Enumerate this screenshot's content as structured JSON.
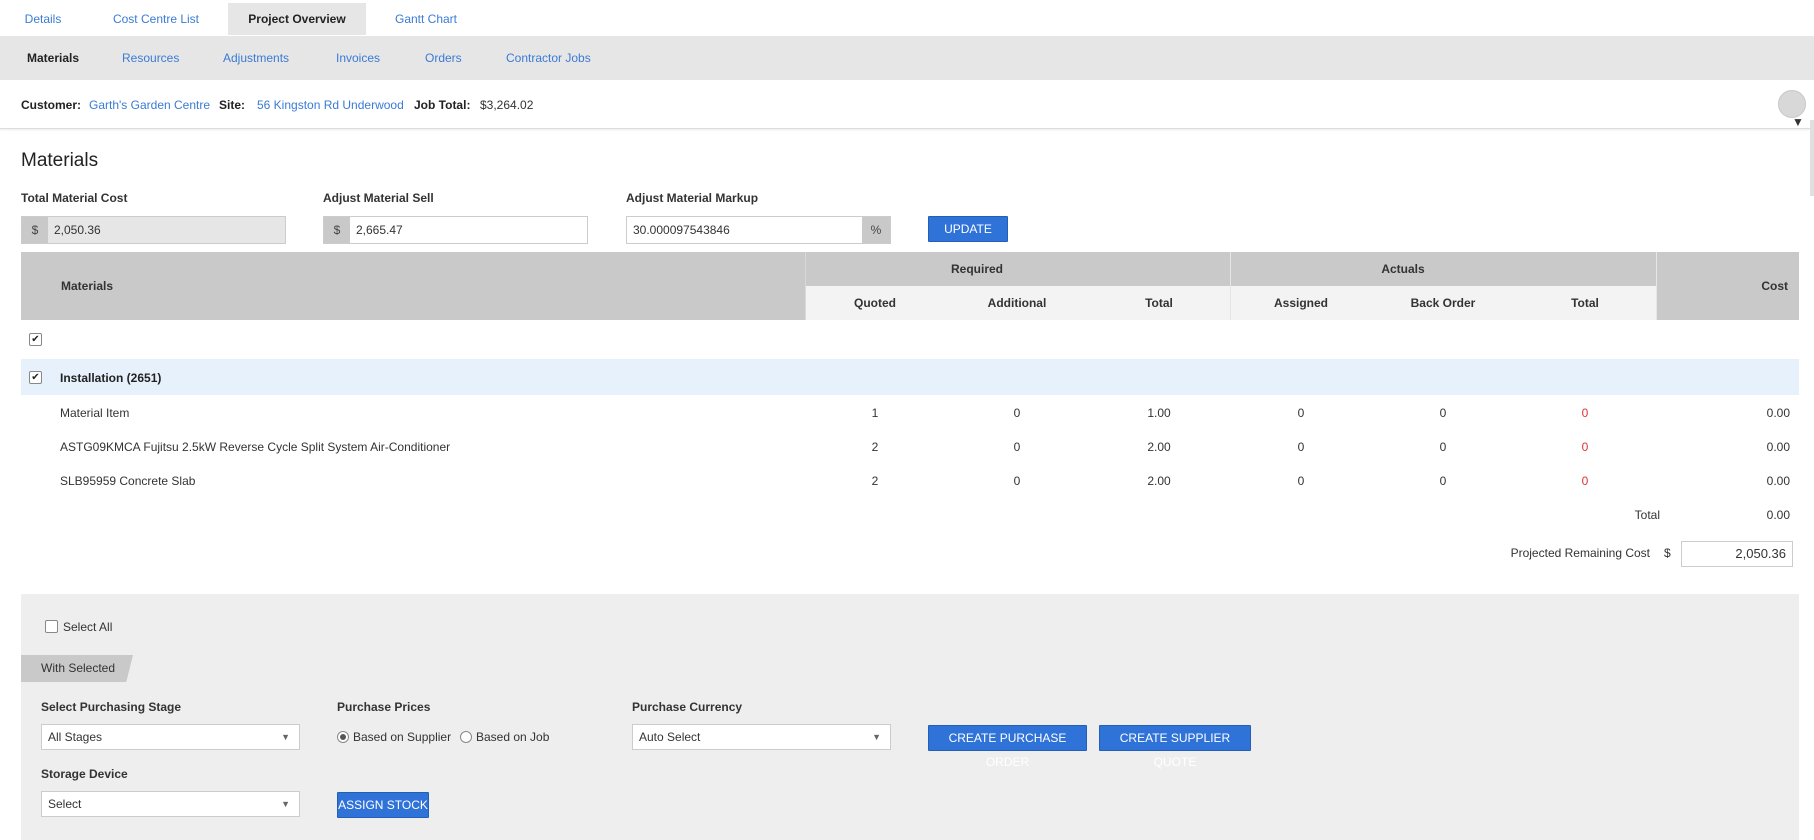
{
  "top_tabs": [
    {
      "label": "Details"
    },
    {
      "label": "Cost Centre List"
    },
    {
      "label": "Project Overview"
    },
    {
      "label": "Gantt Chart"
    }
  ],
  "subnav": [
    {
      "label": "Materials"
    },
    {
      "label": "Resources"
    },
    {
      "label": "Adjustments"
    },
    {
      "label": "Invoices"
    },
    {
      "label": "Orders"
    },
    {
      "label": "Contractor Jobs"
    }
  ],
  "info": {
    "customer_label": "Customer:",
    "customer": "Garth's Garden Centre",
    "site_label": "Site:",
    "site": "56 Kingston Rd Underwood",
    "job_total_label": "Job Total:",
    "job_total": "$3,264.02"
  },
  "page_title": "Materials",
  "cost_fields": {
    "total_cost_label": "Total Material Cost",
    "total_cost_prefix": "$",
    "total_cost_value": "2,050.36",
    "sell_label": "Adjust Material Sell",
    "sell_prefix": "$",
    "sell_value": "2,665.47",
    "markup_label": "Adjust Material Markup",
    "markup_value": "30.000097543846",
    "markup_suffix": "%",
    "update_button": "UPDATE"
  },
  "table": {
    "col_materials": "Materials",
    "group_required": "Required",
    "group_actuals": "Actuals",
    "col_cost": "Cost",
    "sub_quoted": "Quoted",
    "sub_additional": "Additional",
    "sub_total_req": "Total",
    "sub_assigned": "Assigned",
    "sub_back_order": "Back Order",
    "sub_total_act": "Total",
    "group_row_label": "Installation (2651)",
    "rows": [
      {
        "name": "Material Item",
        "quoted": "1",
        "additional": "0",
        "total": "1.00",
        "assigned": "0",
        "back_order": "0",
        "act_total": "0",
        "cost": "0.00"
      },
      {
        "name": "ASTG09KMCA Fujitsu 2.5kW Reverse Cycle Split System Air-Conditioner",
        "quoted": "2",
        "additional": "0",
        "total": "2.00",
        "assigned": "0",
        "back_order": "0",
        "act_total": "0",
        "cost": "0.00"
      },
      {
        "name": "SLB95959 Concrete Slab",
        "quoted": "2",
        "additional": "0",
        "total": "2.00",
        "assigned": "0",
        "back_order": "0",
        "act_total": "0",
        "cost": "0.00"
      }
    ],
    "total_label": "Total",
    "total_value": "0.00",
    "projected_label": "Projected Remaining Cost",
    "projected_prefix": "$",
    "projected_value": "2,050.36"
  },
  "bottom": {
    "select_all": "Select All",
    "with_selected": "With Selected",
    "stage_label": "Select Purchasing Stage",
    "stage_value": "All Stages",
    "prices_label": "Purchase Prices",
    "price_supplier": "Based on Supplier",
    "price_job": "Based on Job",
    "currency_label": "Purchase Currency",
    "currency_value": "Auto Select",
    "create_po": "CREATE PURCHASE ORDER",
    "create_quote": "CREATE SUPPLIER QUOTE",
    "storage_label": "Storage Device",
    "storage_value": "Select",
    "assign_stock": "ASSIGN STOCK"
  },
  "colors": {
    "accent": "#2f72d8",
    "link": "#3a7bd5",
    "header_bg": "#c9c9c9",
    "group_row_bg": "#e6f1fb",
    "negative": "#dd3333"
  }
}
